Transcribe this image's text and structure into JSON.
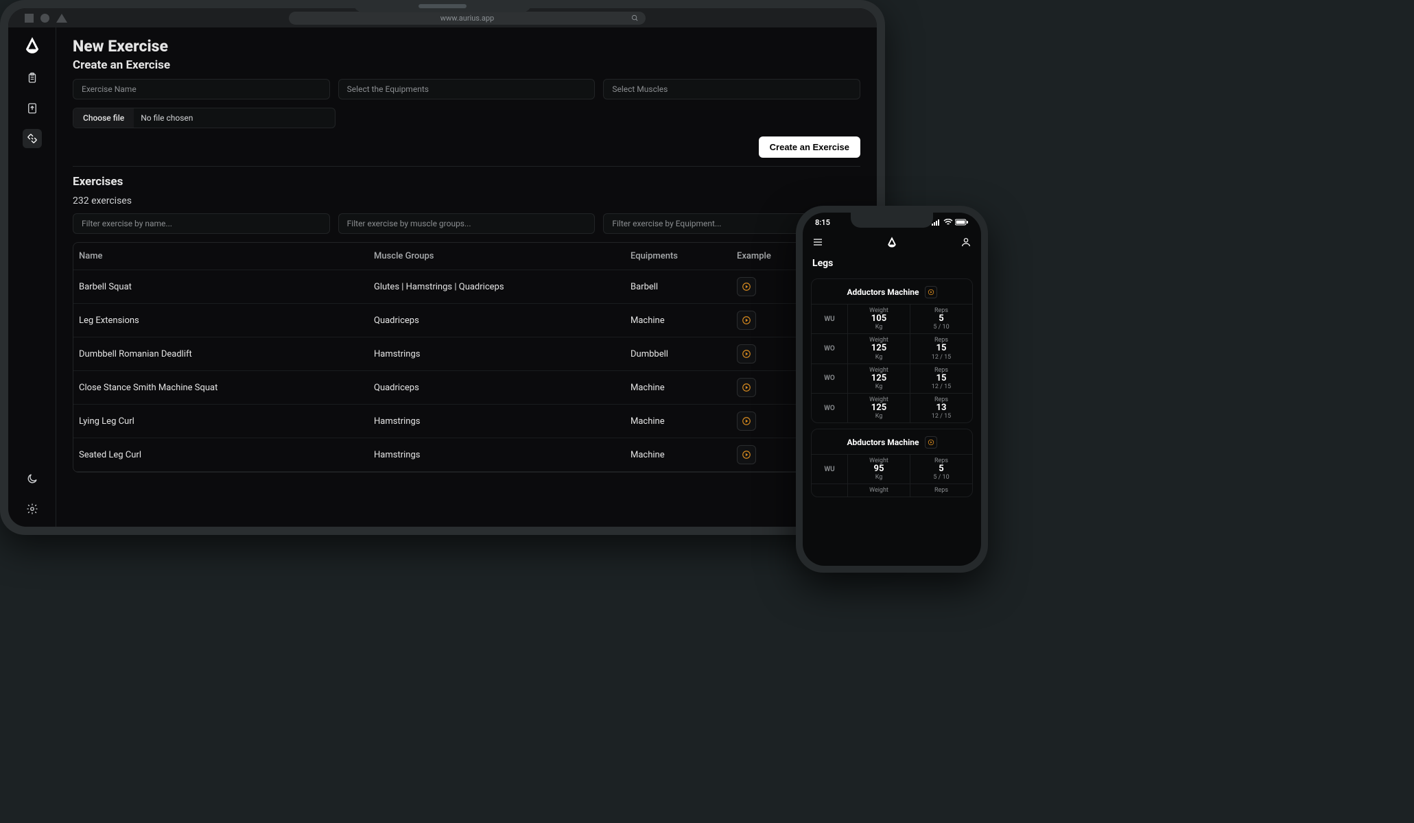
{
  "browser": {
    "url": "www.aurius.app"
  },
  "page": {
    "title": "New Exercise",
    "create_heading": "Create an Exercise",
    "exercise_name_ph": "Exercise Name",
    "select_equip_ph": "Select the Equipments",
    "select_muscles_ph": "Select Muscles",
    "choose_file_label": "Choose file",
    "no_file": "No file chosen",
    "create_btn": "Create an Exercise",
    "list_heading": "Exercises",
    "count": "232 exercises",
    "filter_name_ph": "Filter exercise by name...",
    "filter_muscle_ph": "Filter exercise by muscle groups...",
    "filter_equip_ph": "Filter exercise by Equipment..."
  },
  "columns": {
    "c0": "Name",
    "c1": "Muscle Groups",
    "c2": "Equipments",
    "c3": "Example"
  },
  "rows": [
    {
      "name": "Barbell Squat",
      "muscle": "Glutes | Hamstrings | Quadriceps",
      "equip": "Barbell"
    },
    {
      "name": "Leg Extensions",
      "muscle": "Quadriceps",
      "equip": "Machine"
    },
    {
      "name": "Dumbbell Romanian Deadlift",
      "muscle": "Hamstrings",
      "equip": "Dumbbell"
    },
    {
      "name": "Close Stance Smith Machine Squat",
      "muscle": "Quadriceps",
      "equip": "Machine"
    },
    {
      "name": "Lying Leg Curl",
      "muscle": "Hamstrings",
      "equip": "Machine"
    },
    {
      "name": "Seated Leg Curl",
      "muscle": "Hamstrings",
      "equip": "Machine"
    }
  ],
  "phone": {
    "time": "8:15",
    "page_title": "Legs",
    "labels": {
      "weight": "Weight",
      "reps": "Reps",
      "wu": "WU",
      "wo": "WO",
      "kg": "Kg"
    },
    "cards": [
      {
        "title": "Adductors Machine",
        "sets": [
          {
            "type": "WU",
            "weight": "105",
            "reps": "5",
            "range": "5 / 10"
          },
          {
            "type": "WO",
            "weight": "125",
            "reps": "15",
            "range": "12 / 15"
          },
          {
            "type": "WO",
            "weight": "125",
            "reps": "15",
            "range": "12 / 15"
          },
          {
            "type": "WO",
            "weight": "125",
            "reps": "13",
            "range": "12 / 15"
          }
        ]
      },
      {
        "title": "Abductors Machine",
        "sets": [
          {
            "type": "WU",
            "weight": "95",
            "reps": "5",
            "range": "5 / 10"
          },
          {
            "type": "",
            "weight": "",
            "reps": "",
            "range": ""
          }
        ]
      }
    ]
  },
  "colors": {
    "accent": "#d78a1f"
  }
}
